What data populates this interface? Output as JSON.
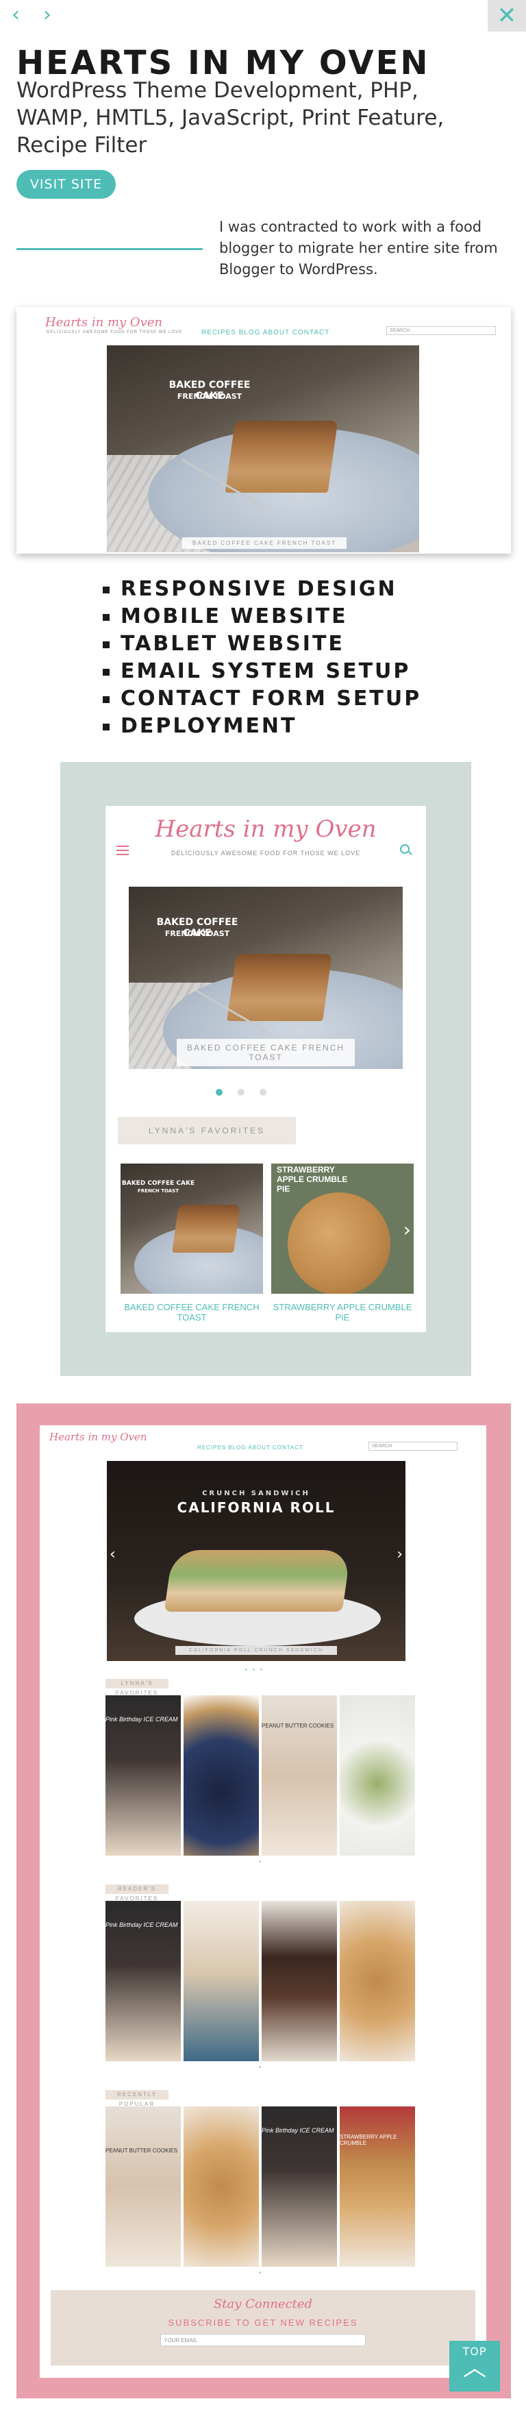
{
  "nav": {
    "prev_icon": "‹",
    "next_icon": "›",
    "close_icon": "✕"
  },
  "project": {
    "title": "Hearts in my Oven",
    "subtitle": "WordPress Theme Development, PHP, WAMP, HMTL5, JavaScript, Print Feature, Recipe Filter",
    "visit_label": "VISIT SITE",
    "intro": "I was contracted to work with a food blogger to migrate her entire site from Blogger to WordPress."
  },
  "features": [
    "Responsive Design",
    "Mobile Website",
    "Tablet Website",
    "Email System Setup",
    "Contact Form Setup",
    "Deployment"
  ],
  "site": {
    "brand": "Hearts in my Oven",
    "tagline": "DELICIOUSLY AWESOME FOOD FOR THOSE WE LOVE",
    "nav": "RECIPES  BLOG  ABOUT  CONTACT",
    "search_placeholder": "SEARCH",
    "hero_title": "BAKED COFFEE CAKE",
    "hero_subtitle": "FRENCH TOAST",
    "hero_signature": "with Jordan",
    "hero_caption": "BAKED COFFEE CAKE FRENCH TOAST",
    "favorites_label": "LYNNA'S FAVORITES",
    "thumb1_caption": "BAKED COFFEE CAKE FRENCH TOAST",
    "thumb2_title": "STRAWBERRY APPLE CRUMBLE PIE",
    "thumb2_caption": "STRAWBERRY APPLE CRUMBLE PIE"
  },
  "desktop": {
    "hero_kicker": "CRUNCH SANDWICH",
    "hero_title": "CALIFORNIA ROLL",
    "hero_caption": "CALIFORNIA ROLL CRUNCH SANDWICH",
    "sections": [
      "LYNNA'S FAVORITES",
      "READER'S FAVORITES",
      "RECENTLY POPULAR"
    ],
    "subscribe_script": "Stay Connected",
    "subscribe_title": "SUBSCRIBE TO GET NEW RECIPES",
    "subscribe_placeholder": "YOUR EMAIL",
    "tile_labels": [
      "Pink Birthday ICE CREAM",
      "PEANUT BUTTER COOKIES",
      "STRAWBERRY APPLE CRUMBLE"
    ]
  },
  "top_button": {
    "label": "TOP",
    "icon": "︿"
  },
  "colors": {
    "accent": "#4dbdb6",
    "brand_pink": "#e0708c",
    "tablet_bg": "#cfdcd7",
    "desktop_bg": "#e8a0ac"
  }
}
